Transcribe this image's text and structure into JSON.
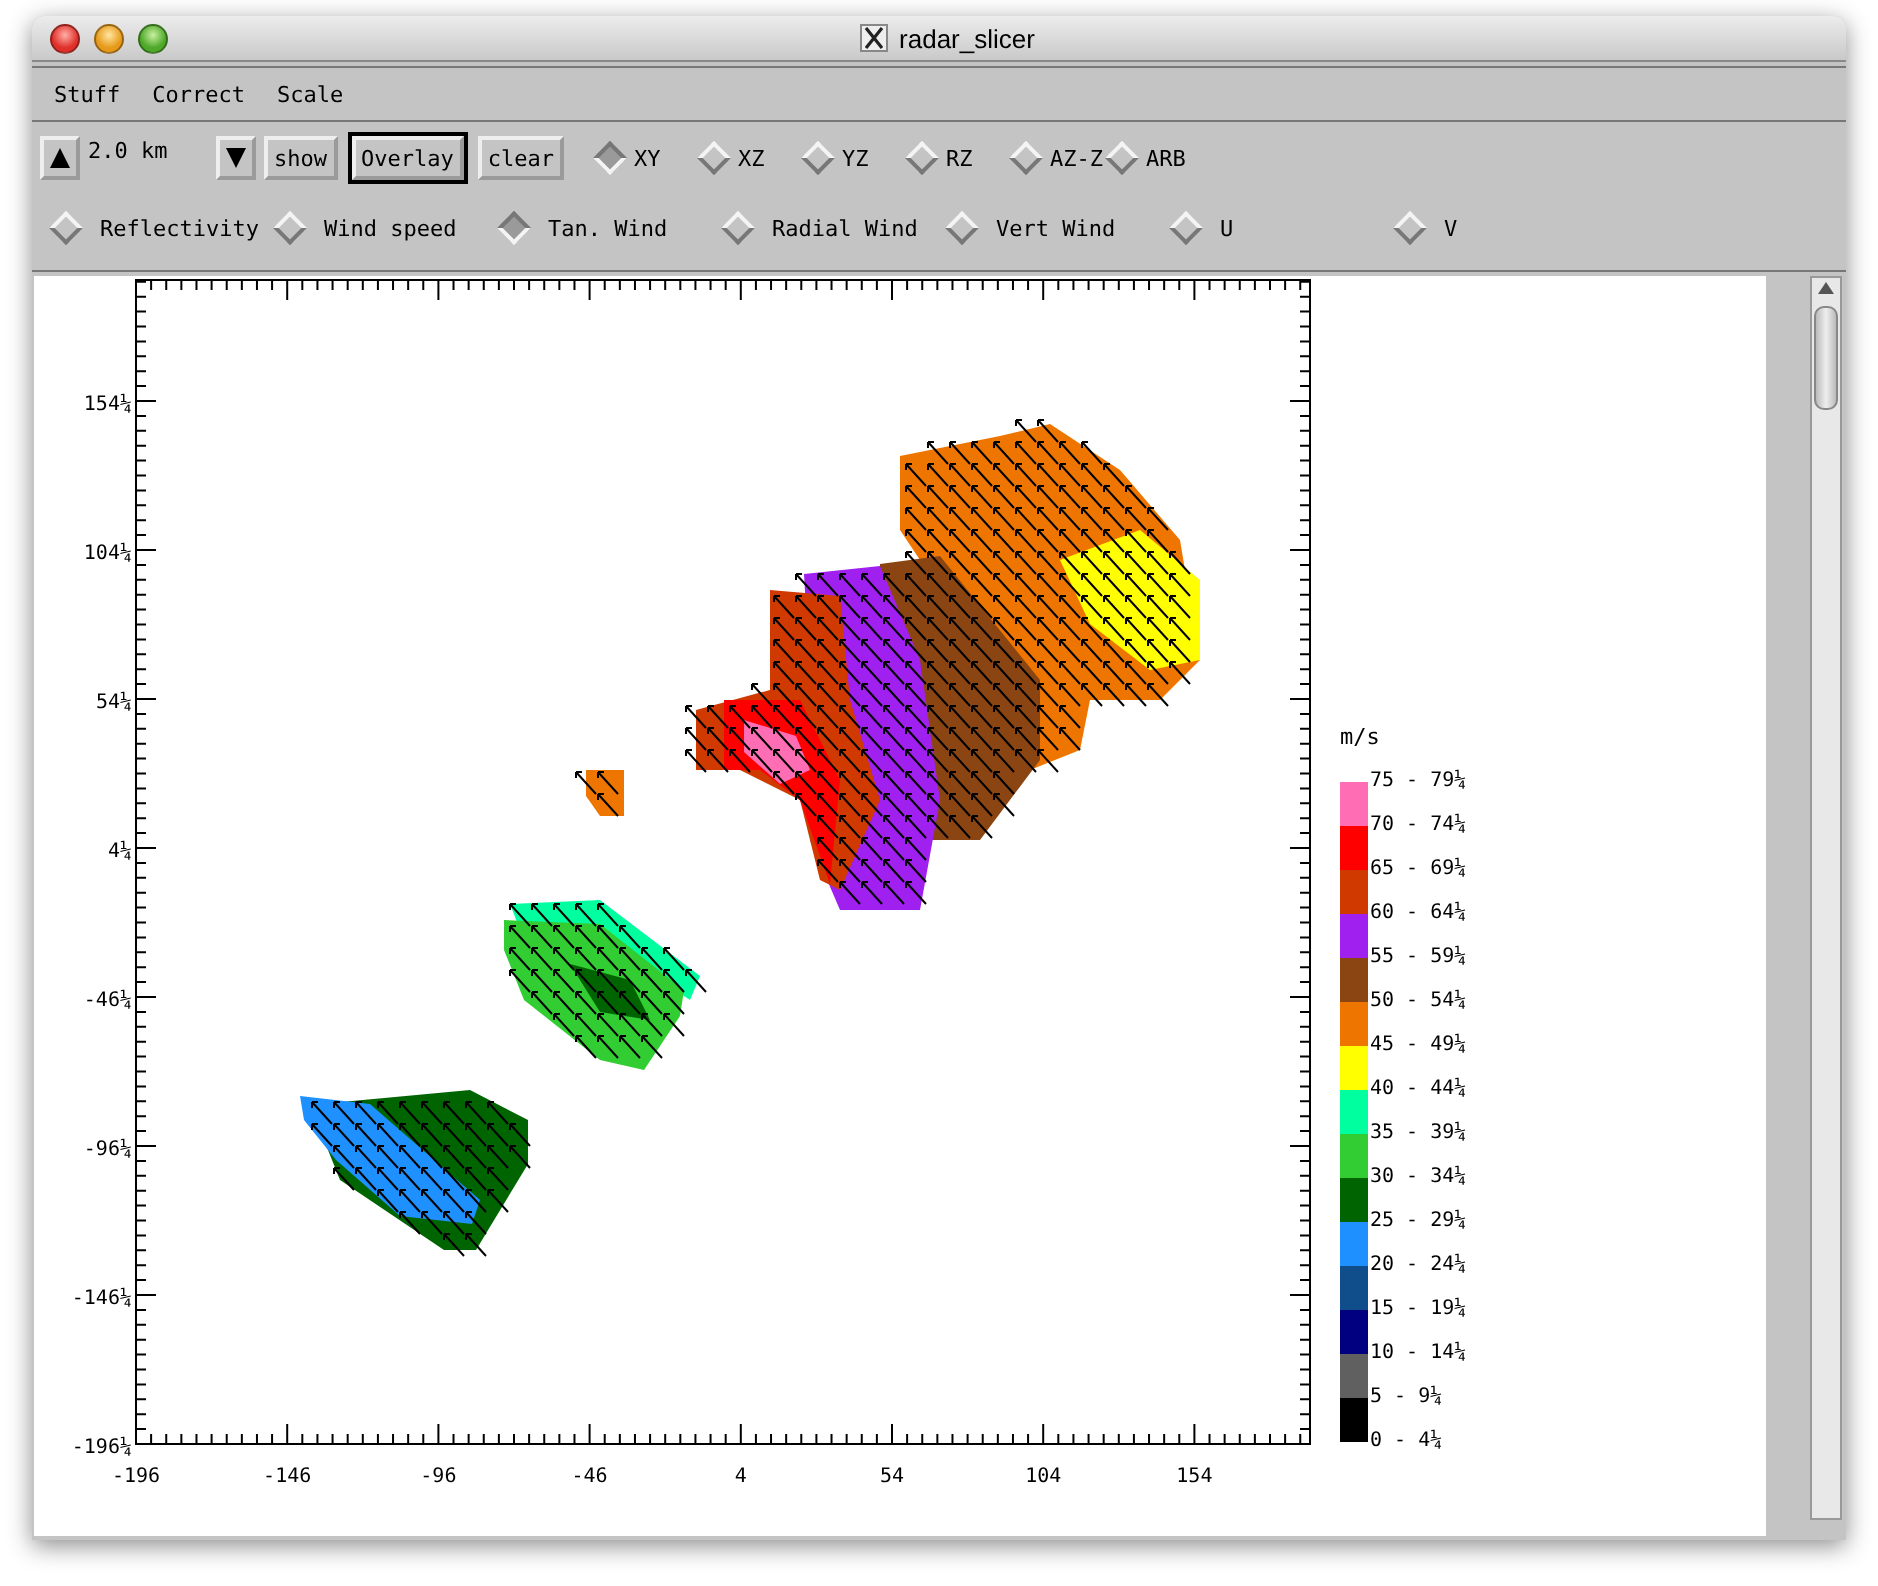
{
  "window": {
    "title": "radar_slicer"
  },
  "menu": [
    "Stuff",
    "Correct",
    "Scale"
  ],
  "toolbar": {
    "height_value": "2.0 km",
    "buttons": [
      {
        "label": "show",
        "default": false
      },
      {
        "label": "Overlay",
        "default": true
      },
      {
        "label": "clear",
        "default": false
      }
    ],
    "planes": [
      {
        "label": "XY",
        "selected": true
      },
      {
        "label": "XZ",
        "selected": false
      },
      {
        "label": "YZ",
        "selected": false
      },
      {
        "label": "RZ",
        "selected": false
      },
      {
        "label": "AZ-Z",
        "selected": false
      },
      {
        "label": "ARB",
        "selected": false
      }
    ],
    "fields": [
      {
        "label": "Reflectivity",
        "selected": false
      },
      {
        "label": "Wind speed",
        "selected": false
      },
      {
        "label": "Tan. Wind",
        "selected": true
      },
      {
        "label": "Radial Wind",
        "selected": false
      },
      {
        "label": "Vert Wind",
        "selected": false
      },
      {
        "label": "U",
        "selected": false
      },
      {
        "label": "V",
        "selected": false
      }
    ]
  },
  "plot": {
    "x_ticks": [
      "-196",
      "-146",
      "-96",
      "-46",
      "4",
      "54",
      "104",
      "154"
    ],
    "y_ticks": [
      "154¼",
      "104¼",
      "54¼",
      "4¼",
      "-46¼",
      "-96¼",
      "-146¼",
      "-196¼"
    ]
  },
  "legend": {
    "unit": "m/s",
    "items": [
      {
        "label": "75 - 79¼"
      },
      {
        "label": "70 - 74¼",
        "color": "#ff6eb4"
      },
      {
        "label": "65 - 69¼",
        "color": "#ff0000"
      },
      {
        "label": "60 - 64¼",
        "color": "#d03a00"
      },
      {
        "label": "55 - 59¼",
        "color": "#a020f0"
      },
      {
        "label": "50 - 54¼",
        "color": "#8b4513"
      },
      {
        "label": "45 - 49¼",
        "color": "#ee7600"
      },
      {
        "label": "40 - 44¼",
        "color": "#ffff00"
      },
      {
        "label": "35 - 39¼",
        "color": "#00ff9f"
      },
      {
        "label": "30 - 34¼",
        "color": "#32cd32"
      },
      {
        "label": "25 - 29¼",
        "color": "#006400"
      },
      {
        "label": "20 - 24¼",
        "color": "#1e90ff"
      },
      {
        "label": "15 - 19¼",
        "color": "#104e8b"
      },
      {
        "label": "10 - 14¼",
        "color": "#000080"
      },
      {
        "label": "5 - 9¼",
        "color": "#606060"
      },
      {
        "label": "0 - 4¼",
        "color": "#000000"
      }
    ]
  }
}
